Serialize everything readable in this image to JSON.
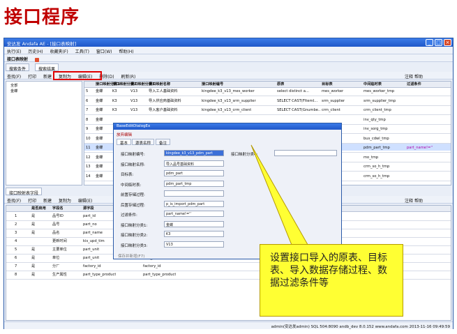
{
  "slide_title": "接口程序",
  "window": {
    "title": "安达发 Andafa AE - [接口表映射]",
    "menu": [
      "执行(E)",
      "历史(H)",
      "收藏夹(F)",
      "工具(T)",
      "窗口(W)",
      "帮助(H)"
    ],
    "doc_tab": "接口表映射",
    "tabs": [
      "搜索条件",
      "搜索结果"
    ],
    "toolbar1": [
      "查找(F)",
      "打印",
      "新建",
      "复制为",
      "编辑(E)",
      "删除(D)",
      "刷新(R)"
    ],
    "note_help": [
      "注释",
      "帮助"
    ]
  },
  "grid1": {
    "tree": [
      "全部",
      "金蝶"
    ],
    "headers": [
      "接口映射分类1",
      "接口映射分类2",
      "接口映射分类3",
      "接口映射名称",
      "接口映射编号",
      "原表",
      "目标表",
      "中间临时表",
      "过滤条件"
    ],
    "rows": [
      [
        "5",
        "金蝶",
        "K3",
        "V13",
        "导入工人基础资料",
        "kingdee_k3_v13_mes_worker",
        "select distinct a...",
        "mes_worker",
        "mes_worker_tmp",
        ""
      ],
      [
        "6",
        "金蝶",
        "K3",
        "V13",
        "导入供应商基础资料",
        "kingdee_k3_v13_srm_supplier",
        "SELECT CAST(FItemI...",
        "srm_supplier",
        "srm_supplier_tmp",
        ""
      ],
      [
        "7",
        "金蝶",
        "K3",
        "V13",
        "导入客户基础资料",
        "kingdee_k3_v13_crm_client",
        "SELECT CAST(Gnumbe...",
        "crm_client",
        "crm_client_tmp",
        ""
      ],
      [
        "8",
        "金蝶",
        "",
        "",
        "",
        "",
        "",
        "",
        "inv_qty_tmp",
        ""
      ],
      [
        "9",
        "金蝶",
        "",
        "",
        "",
        "",
        "",
        "",
        "inv_sorg_tmp",
        ""
      ],
      [
        "10",
        "金蝶",
        "",
        "",
        "",
        "",
        "",
        "",
        "bus_cdwl_tmp",
        ""
      ],
      [
        "11",
        "金蝶",
        "",
        "",
        "",
        "",
        "",
        "",
        "pdm_part_tmp",
        "part_name!=''"
      ],
      [
        "12",
        "金蝶",
        "",
        "",
        "",
        "",
        "",
        "",
        "mo_tmp",
        ""
      ],
      [
        "13",
        "金蝶",
        "",
        "",
        "",
        "",
        "",
        "",
        "crm_so_h_tmp",
        ""
      ],
      [
        "14",
        "金蝶",
        "",
        "",
        "",
        "",
        "",
        "",
        "crm_so_h_tmp",
        ""
      ]
    ]
  },
  "bottom_tab": "接口映射表字段",
  "grid2": {
    "headers": [
      "是否启用",
      "字段名",
      "源字段",
      "中间表字段"
    ],
    "rows": [
      [
        "1",
        "是",
        "品号ID",
        "part_id",
        ""
      ],
      [
        "2",
        "是",
        "品号",
        "part_no",
        ""
      ],
      [
        "3",
        "是",
        "品名",
        "part_name",
        ""
      ],
      [
        "4",
        "",
        "更新时间",
        "kis_upd_tim",
        ""
      ],
      [
        "5",
        "是",
        "主要单位",
        "part_unit",
        ""
      ],
      [
        "6",
        "是",
        "单位",
        "part_unit",
        "part_unit2"
      ],
      [
        "7",
        "是",
        "分厂",
        "factory_id",
        "factory_id"
      ],
      [
        "8",
        "是",
        "生产属性",
        "part_type_product",
        "part_type_product"
      ]
    ]
  },
  "dialog": {
    "title": "BaseEditDialogEx",
    "toolbar": "放弃编辑",
    "tabs": [
      "基本",
      "源表名称",
      "备注"
    ],
    "fields": [
      {
        "label": "接口映射编号:",
        "value": "kingdee_k3_v13_pdm_part"
      },
      {
        "label": "接口映射名称:",
        "value": "导入品号基础资料"
      },
      {
        "label": "目标表:",
        "value": "pdm_part"
      },
      {
        "label": "中间临时表:",
        "value": "pdm_part_tmp"
      },
      {
        "label": "前置存储过程:",
        "value": ""
      },
      {
        "label": "后置存储过程:",
        "value": "p_is_import_pdm_part"
      },
      {
        "label": "过滤条件:",
        "value": "part_name!=''"
      },
      {
        "label": "接口映射分类1:",
        "value": "金蝶"
      },
      {
        "label": "接口映射分类2:",
        "value": "K3"
      },
      {
        "label": "接口映射分类3:",
        "value": "V13"
      }
    ],
    "right_label": "接口映射分类4:",
    "save_label": "保存并新增(F7)"
  },
  "callout": "设置接口导入的原表、目标表、导入数据存储过程、数据过滤条件等",
  "status": "admin(安达发admin)  SQL 504:8090  andb_dev  8.0.152  www.andafa.com  2013-11-16 09:49:59",
  "colors": {
    "title": "#c00000",
    "titlebar": "#2a63d4",
    "callout": "#ffff33",
    "highlight": "#e00000",
    "selected": "#3b6fd8"
  }
}
